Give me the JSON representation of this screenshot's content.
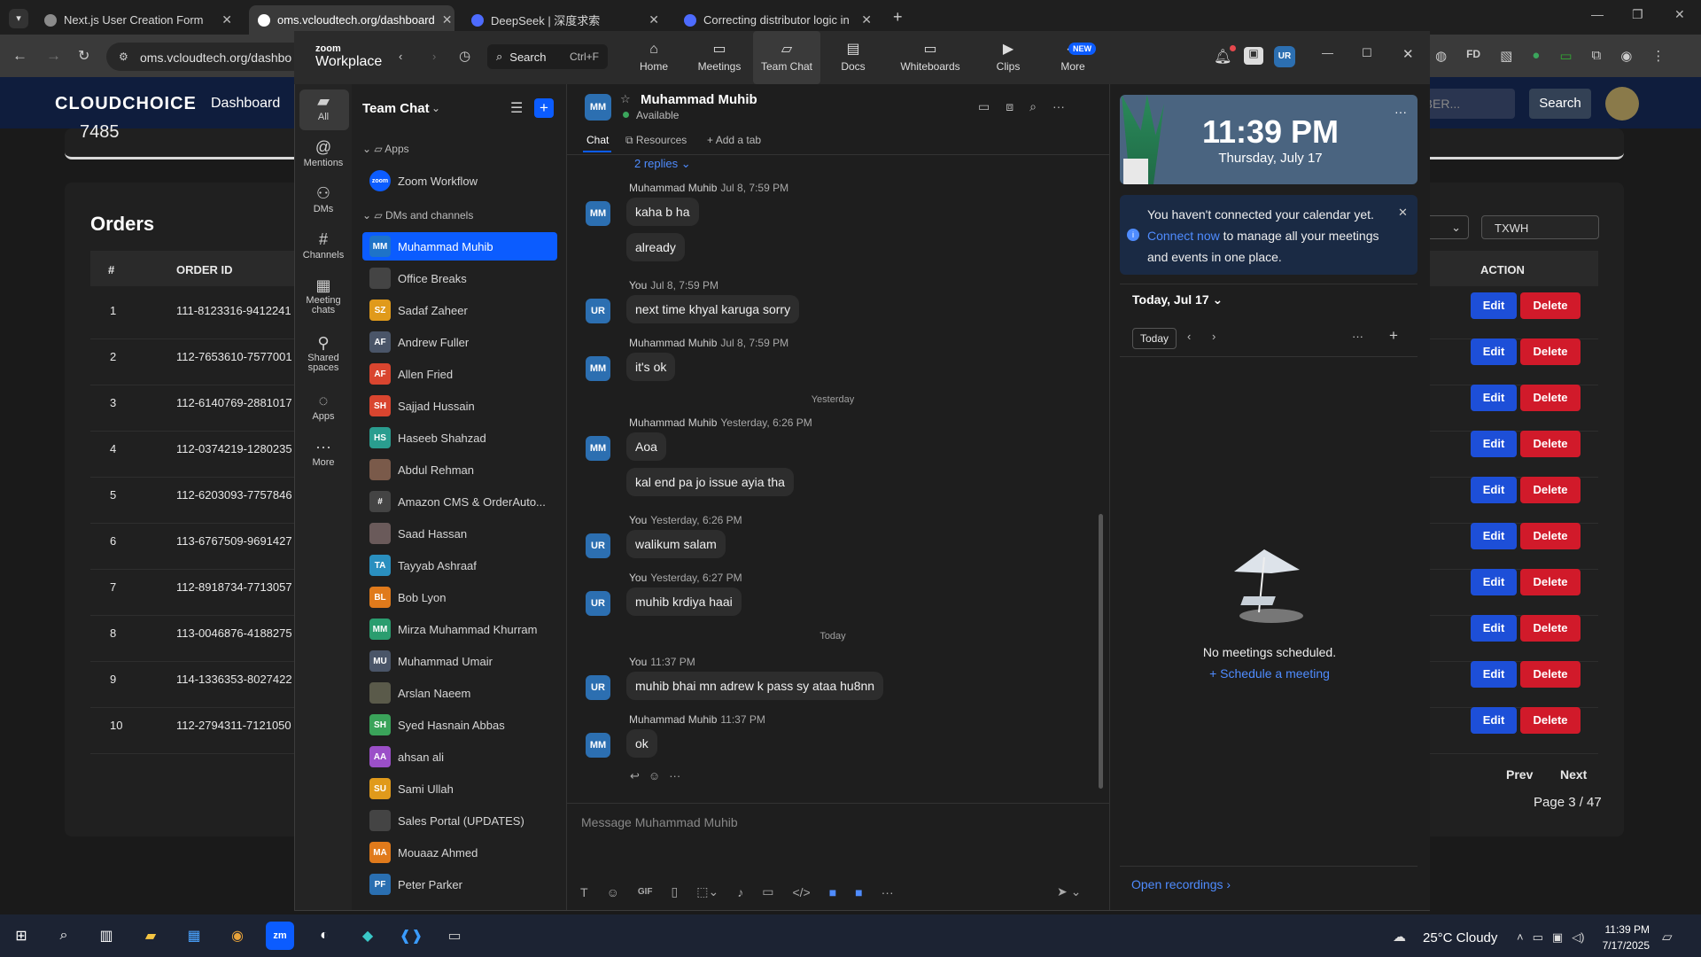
{
  "browser": {
    "tabs": [
      {
        "title": "Next.js User Creation Form"
      },
      {
        "title": "oms.vcloudtech.org/dashboard"
      },
      {
        "title": "DeepSeek | 深度求索"
      },
      {
        "title": "Correcting distributor logic in Ja"
      }
    ],
    "url": "oms.vcloudtech.org/dashbo"
  },
  "webapp": {
    "brand": "CLOUDCHOICE",
    "nav_dashboard": "Dashboard",
    "top_number": "7485",
    "search_placeholder": "MBER...",
    "search_label": "Search",
    "filter_value": "TXWH",
    "orders_title": "Orders",
    "col_num": "#",
    "col_order_id": "ORDER ID",
    "col_action": "ACTION",
    "rows": [
      {
        "n": "1",
        "id": "111-8123316-9412241"
      },
      {
        "n": "2",
        "id": "112-7653610-7577001"
      },
      {
        "n": "3",
        "id": "112-6140769-2881017"
      },
      {
        "n": "4",
        "id": "112-0374219-1280235"
      },
      {
        "n": "5",
        "id": "112-6203093-7757846"
      },
      {
        "n": "6",
        "id": "113-6767509-9691427"
      },
      {
        "n": "7",
        "id": "112-8918734-7713057"
      },
      {
        "n": "8",
        "id": "113-0046876-4188275"
      },
      {
        "n": "9",
        "id": "114-1336353-8027422"
      },
      {
        "n": "10",
        "id": "112-2794311-7121050"
      }
    ],
    "edit_label": "Edit",
    "delete_label": "Delete",
    "prev_label": "Prev",
    "next_label": "Next",
    "page_info": "Page 3 / 47"
  },
  "zoom": {
    "brand_top": "zoom",
    "brand_bottom": "Workplace",
    "search_label": "Search",
    "search_shortcut": "Ctrl+F",
    "tabs": [
      {
        "label": "Home"
      },
      {
        "label": "Meetings"
      },
      {
        "label": "Team Chat"
      },
      {
        "label": "Docs"
      },
      {
        "label": "Whiteboards"
      },
      {
        "label": "Clips"
      },
      {
        "label": "More"
      }
    ],
    "new_badge": "NEW",
    "user_initials": "UR",
    "rail": [
      {
        "label": "All"
      },
      {
        "label": "Mentions"
      },
      {
        "label": "DMs"
      },
      {
        "label": "Channels"
      },
      {
        "label": "Meeting chats"
      },
      {
        "label": "Shared spaces"
      },
      {
        "label": "Apps"
      },
      {
        "label": "More"
      }
    ],
    "panel_title": "Team Chat",
    "section_apps": "Apps",
    "app_item": "Zoom Workflow",
    "section_dms": "DMs and channels",
    "contacts": [
      {
        "initials": "MM",
        "name": "Muhammad Muhib",
        "color": "#1e73c8"
      },
      {
        "initials": "",
        "name": "Office Breaks",
        "color": "#444444"
      },
      {
        "initials": "SZ",
        "name": "Sadaf Zaheer",
        "color": "#e09a1b"
      },
      {
        "initials": "AF",
        "name": "Andrew Fuller",
        "color": "#4a5568"
      },
      {
        "initials": "AF",
        "name": "Allen Fried",
        "color": "#d9452f"
      },
      {
        "initials": "SH",
        "name": "Sajjad Hussain",
        "color": "#d9452f"
      },
      {
        "initials": "HS",
        "name": "Haseeb Shahzad",
        "color": "#2a9d8f"
      },
      {
        "initials": "",
        "name": "Abdul Rehman",
        "color": "#7a5a4a"
      },
      {
        "initials": "#",
        "name": "Amazon CMS & OrderAuto...",
        "color": "#444444"
      },
      {
        "initials": "",
        "name": "Saad Hassan",
        "color": "#6a5a5a"
      },
      {
        "initials": "TA",
        "name": "Tayyab Ashraaf",
        "color": "#2a8fbf"
      },
      {
        "initials": "BL",
        "name": "Bob Lyon",
        "color": "#e07a1b"
      },
      {
        "initials": "MM",
        "name": "Mirza Muhammad Khurram",
        "color": "#2a9d6f"
      },
      {
        "initials": "MU",
        "name": "Muhammad Umair",
        "color": "#4a5568"
      },
      {
        "initials": "",
        "name": "Arslan Naeem",
        "color": "#5a5a4a"
      },
      {
        "initials": "SH",
        "name": "Syed Hasnain Abbas",
        "color": "#3aa35a"
      },
      {
        "initials": "AA",
        "name": "ahsan ali",
        "color": "#9b4fc8"
      },
      {
        "initials": "SU",
        "name": "Sami Ullah",
        "color": "#e09a1b"
      },
      {
        "initials": "",
        "name": "Sales Portal (UPDATES)",
        "color": "#444444"
      },
      {
        "initials": "MA",
        "name": "Mouaaz Ahmed",
        "color": "#e07a1b"
      },
      {
        "initials": "PF",
        "name": "Peter Parker",
        "color": "#2a6fb1"
      }
    ],
    "chat": {
      "contact_name": "Muhammad Muhib",
      "contact_initials": "MM",
      "status": "Available",
      "tab_chat": "Chat",
      "tab_resources": "Resources",
      "tab_add": "Add a tab",
      "replies": "2 replies",
      "day_yesterday": "Yesterday",
      "day_today": "Today",
      "messages": [
        {
          "initials": "MM",
          "sender": "Muhammad Muhib",
          "time": "Jul 8, 7:59 PM",
          "texts": [
            "kaha b ha",
            "already"
          ]
        },
        {
          "initials": "UR",
          "sender": "You",
          "time": "Jul 8, 7:59 PM",
          "texts": [
            "next time khyal karuga sorry"
          ]
        },
        {
          "initials": "MM",
          "sender": "Muhammad Muhib",
          "time": "Jul 8, 7:59 PM",
          "texts": [
            "it's ok"
          ]
        },
        {
          "initials": "MM",
          "sender": "Muhammad Muhib",
          "time": "Yesterday, 6:26 PM",
          "texts": [
            "Aoa",
            "kal end pa jo issue ayia tha"
          ]
        },
        {
          "initials": "UR",
          "sender": "You",
          "time": "Yesterday, 6:26 PM",
          "texts": [
            "walikum salam"
          ]
        },
        {
          "initials": "UR",
          "sender": "You",
          "time": "Yesterday, 6:27 PM",
          "texts": [
            "muhib krdiya haai"
          ]
        },
        {
          "initials": "UR",
          "sender": "You",
          "time": "11:37 PM",
          "texts": [
            "muhib bhai mn adrew k pass sy ataa hu8nn"
          ]
        },
        {
          "initials": "MM",
          "sender": "Muhammad Muhib",
          "time": "11:37 PM",
          "texts": [
            "ok"
          ]
        }
      ],
      "composer_placeholder": "Message Muhammad Muhib",
      "gif_label": "GIF"
    },
    "calendar": {
      "time": "11:39 PM",
      "date": "Thursday, July 17",
      "banner_text": "You haven't connected your calendar yet.",
      "banner_link": "Connect now",
      "banner_rest": "to manage all your meetings and events in one place.",
      "day_label": "Today, Jul 17",
      "today_btn": "Today",
      "empty_text": "No meetings scheduled.",
      "schedule_link": "Schedule a meeting",
      "recordings_link": "Open recordings"
    }
  },
  "taskbar": {
    "weather": "25°C  Cloudy",
    "time": "11:39 PM",
    "date": "7/17/2025"
  },
  "colors": {
    "zoom_blue": "#0b5cff",
    "edit_blue": "#1d4fd8",
    "delete_red": "#d11a2a"
  }
}
